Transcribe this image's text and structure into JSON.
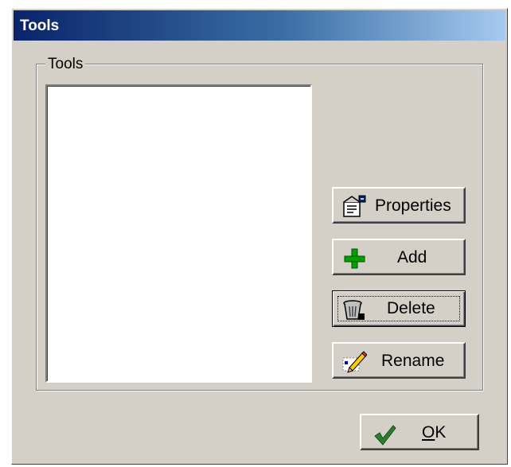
{
  "window": {
    "title": "Tools"
  },
  "group": {
    "legend": "Tools"
  },
  "tools_list": {
    "items": []
  },
  "buttons": {
    "properties": "Properties",
    "add": "Add",
    "delete": "Delete",
    "rename": "Rename",
    "ok_mnemonic": "O",
    "ok_rest": "K"
  },
  "icons": {
    "properties": "properties-icon",
    "add": "green-plus-icon",
    "delete": "trash-can-icon",
    "rename": "pencil-icon",
    "ok": "green-checkmark-icon"
  },
  "colors": {
    "dialog_face": "#d4d0c8",
    "title_gradient_start": "#0a246a",
    "title_gradient_end": "#a6caf0",
    "add_icon": "#00a000",
    "ok_icon": "#2e7d2e"
  }
}
